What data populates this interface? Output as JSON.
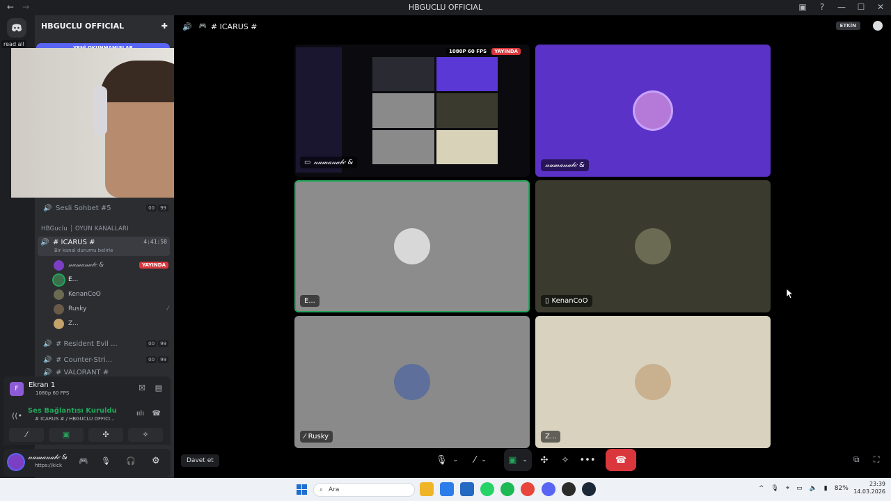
{
  "window": {
    "title": "HBGUCLU OFFICIAL"
  },
  "rail": {
    "read_all": "read all"
  },
  "server": {
    "name": "HBGUCLU OFFICIAL",
    "unread_banner": "YENİ OKUNMAMIŞLAR"
  },
  "channels": {
    "sesli5": {
      "name": "Sesli Sohbet #5",
      "count_a": "00",
      "count_b": "99"
    },
    "category": "HBGuclu ┆ OYUN KANALLARI",
    "icarus": {
      "name": "# ICARUS #",
      "time": "4:41:58",
      "status": "Bir kanal durumu belirle"
    },
    "resident": {
      "name": "# Resident Evil ...",
      "count_a": "00",
      "count_b": "99"
    },
    "counter": {
      "name": "# Counter-Stri...",
      "count_a": "00",
      "count_b": "99"
    },
    "valorant": {
      "name": "# VALORANT #"
    }
  },
  "voice_users": [
    {
      "name": "𝓃𝓊𝓂𝒶𝓃𝒶𝒷𝑒 &",
      "badge": "YAYINDA"
    },
    {
      "name": "E..."
    },
    {
      "name": "KenanCoO"
    },
    {
      "name": "Rusky"
    },
    {
      "name": "Z..."
    }
  ],
  "screen_panel": {
    "title": "Ekran 1",
    "quality": "1080p 60 FPS"
  },
  "voice_panel": {
    "status": "Ses Bağlantısı Kuruldu",
    "channel": "# ICARUS # / HBGUCLU OFFICI..."
  },
  "user_panel": {
    "name": "𝓃𝓊𝓂𝒶𝓃𝒶𝒷𝑒 &",
    "sub": "https://kick"
  },
  "stage": {
    "channel_title": "# ICARUS #",
    "etkin": "ETKİN",
    "stream_quality": "1080P 60 FPS",
    "stream_live": "YAYINDA",
    "tiles": {
      "stream": "𝓃𝓊𝓂𝒶𝓃𝒶𝒷𝑒 &",
      "numanabe": "𝓃𝓊𝓂𝒶𝓃𝒶𝒷𝑒 &",
      "e": "E...",
      "kenan": "KenanCoO",
      "rusky": "Rusky",
      "z": "Z..."
    }
  },
  "invite": "Davet et",
  "taskbar": {
    "search": "Ara",
    "battery": "82%",
    "time": "23:39",
    "date": "14.03.2026"
  },
  "colors": {
    "accent": "#5865f2",
    "live": "#da373c",
    "hangup": "#da373c",
    "connected": "#23a55a"
  }
}
